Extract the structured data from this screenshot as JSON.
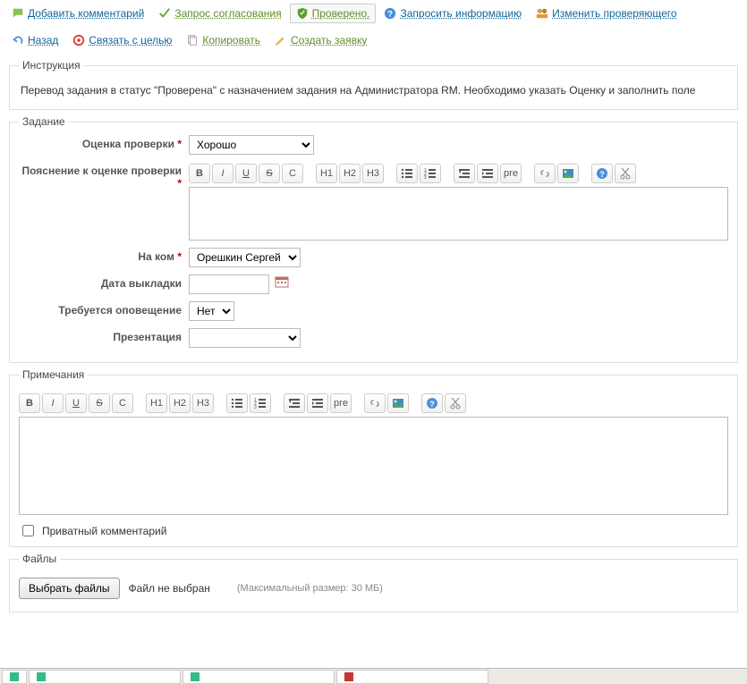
{
  "toolbar": {
    "add_comment": "Добавить комментарий",
    "approval_request": "Запрос согласования",
    "verified": "Проверено.",
    "request_info": "Запросить информацию",
    "change_reviewer": "Изменить проверяющего",
    "back": "Назад",
    "link_goal": "Связать с целью",
    "copy": "Копировать",
    "create_ticket": "Создать заявку"
  },
  "instruction": {
    "legend": "Инструкция",
    "text": "Перевод задания в статус \"Проверена\" с назначением задания на Администратора RM. Необходимо указать Оценку и заполнить поле"
  },
  "task": {
    "legend": "Задание",
    "rating_label": "Оценка проверки",
    "rating_value": "Хорошо",
    "rating_explanation_label": "Пояснение к оценке проверки",
    "assignee_label": "На ком",
    "assignee_value": "Орешкин Сергей",
    "deploy_date_label": "Дата выкладки",
    "notify_label": "Требуется оповещение",
    "notify_value": "Нет",
    "presentation_label": "Презентация"
  },
  "notes": {
    "legend": "Примечания",
    "private_label": "Приватный комментарий"
  },
  "files": {
    "legend": "Файлы",
    "choose_btn": "Выбрать файлы",
    "no_file": "Файл не выбран",
    "hint": "(Максимальный размер: 30 МБ)"
  },
  "rte": {
    "bold": "B",
    "italic": "I",
    "underline": "U",
    "strike": "S",
    "code": "C",
    "h1": "H1",
    "h2": "H2",
    "h3": "H3",
    "pre": "pre"
  }
}
